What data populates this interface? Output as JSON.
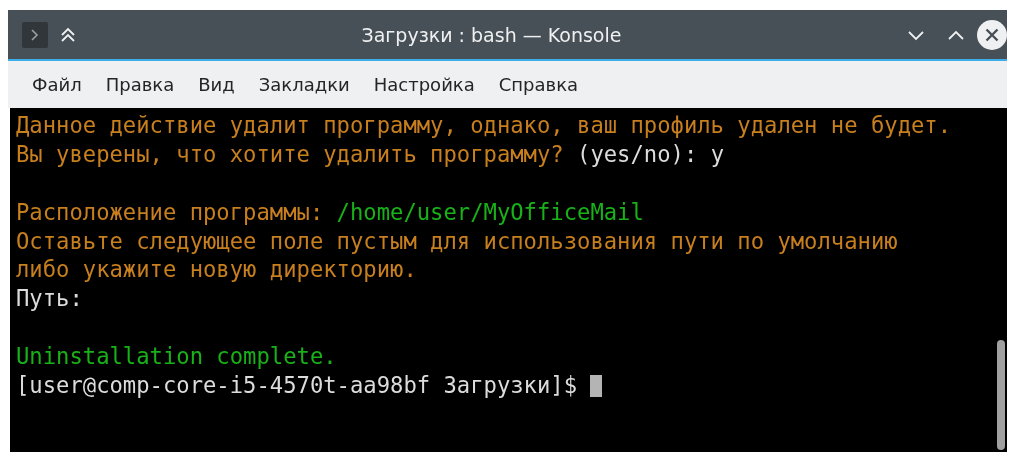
{
  "window": {
    "title": "Загрузки : bash — Konsole"
  },
  "menu": [
    "Файл",
    "Правка",
    "Вид",
    "Закладки",
    "Настройка",
    "Справка"
  ],
  "terminal": {
    "lines": [
      {
        "kind": "text",
        "segments": [
          {
            "text": "Данное действие удалит программу, однако, ваш профиль удален не будет.",
            "color": "#c87f1e"
          }
        ]
      },
      {
        "kind": "text",
        "segments": [
          {
            "text": "Вы уверены, что хотите удалить программу? ",
            "color": "#c87f1e"
          },
          {
            "text": "(yes/no): y",
            "color": "#dcdcdc"
          }
        ]
      },
      {
        "kind": "blank"
      },
      {
        "kind": "text",
        "segments": [
          {
            "text": "Расположение программы: ",
            "color": "#c87f1e"
          },
          {
            "text": "/home/user/MyOfficeMail",
            "color": "#18b218"
          }
        ]
      },
      {
        "kind": "text",
        "segments": [
          {
            "text": "Оставьте следующее поле пустым для использования пути по умолчанию",
            "color": "#c87f1e"
          }
        ]
      },
      {
        "kind": "text",
        "segments": [
          {
            "text": "либо укажите новую директорию.",
            "color": "#c87f1e"
          }
        ]
      },
      {
        "kind": "text",
        "segments": [
          {
            "text": "Путь:",
            "color": "#dcdcdc"
          }
        ]
      },
      {
        "kind": "blank"
      },
      {
        "kind": "text",
        "segments": [
          {
            "text": "Uninstallation complete.",
            "color": "#18b218"
          }
        ]
      },
      {
        "kind": "prompt",
        "segments": [
          {
            "text": "[user@comp-core-i5-4570t-aa98bf Загрузки]$ ",
            "color": "#dcdcdc"
          }
        ]
      }
    ]
  }
}
